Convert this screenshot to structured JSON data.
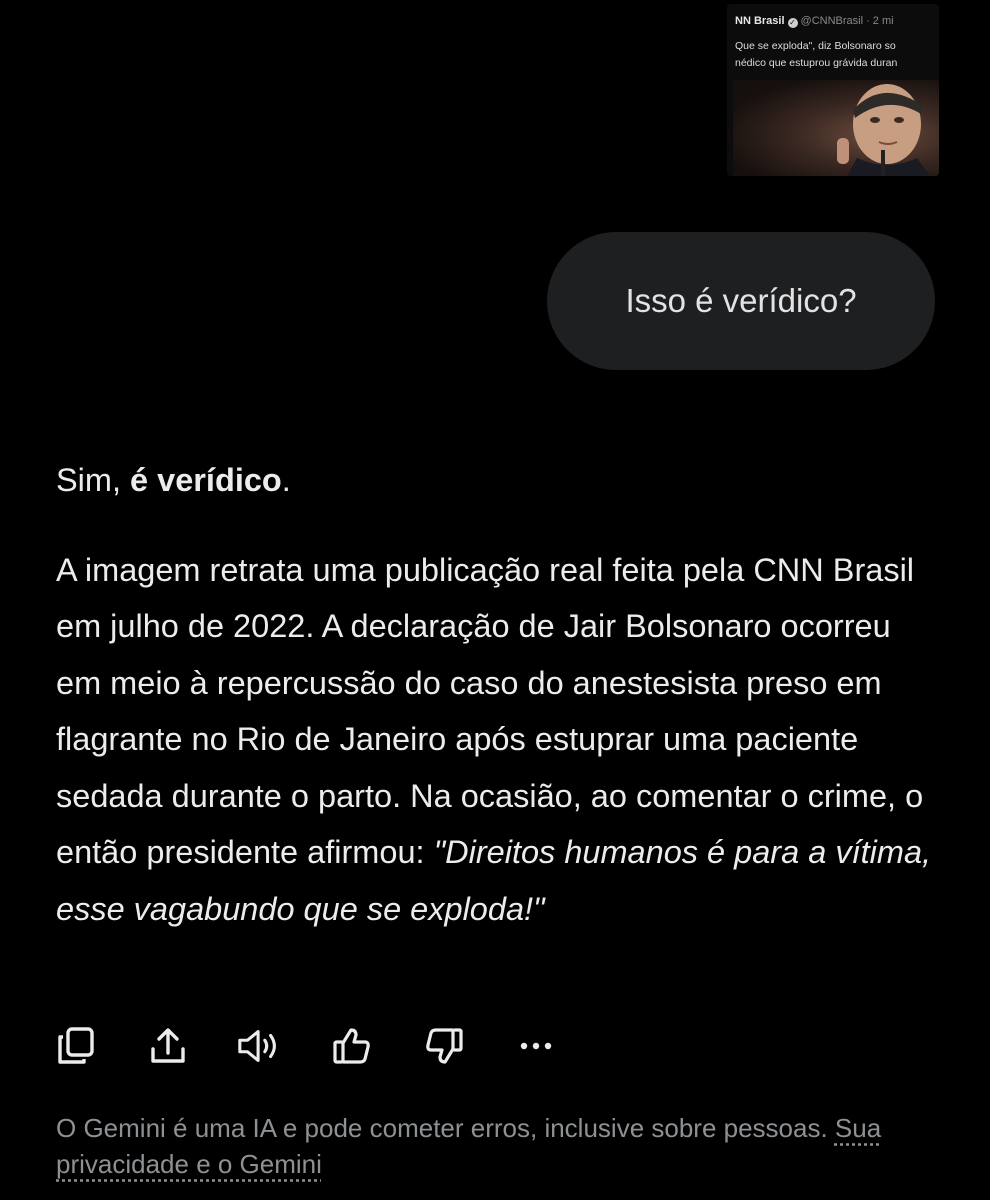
{
  "attachment": {
    "account_name": "NN Brasil",
    "account_meta": "@CNNBrasil · 2 mi",
    "line1": "Que se exploda\", diz Bolsonaro so",
    "line2": "nédico que estuprou grávida duran"
  },
  "user_prompt": "Isso é verídico?",
  "response": {
    "lead_plain": "Sim, ",
    "lead_bold": "é verídico",
    "lead_end": ".",
    "body": "A imagem retrata uma publicação real feita pela CNN Brasil em julho de 2022. A declaração de Jair Bolsonaro ocorreu em meio à repercussão do caso do anestesista preso em flagrante no Rio de Janeiro após estuprar uma paciente sedada durante o parto. Na ocasião, ao comentar o crime, o então presidente afirmou: ",
    "quote": "\"Direitos humanos é para a vítima, esse vagabundo que se exploda!\""
  },
  "actions": {
    "icons": [
      "copy-icon",
      "share-icon",
      "listen-icon",
      "thumbs-up-icon",
      "thumbs-down-icon",
      "more-options-icon"
    ]
  },
  "disclaimer": {
    "text": "O Gemini é uma IA e pode cometer erros, inclusive sobre pessoas. ",
    "link": "Sua privacidade e o Gemini"
  },
  "colors": {
    "background": "#000000",
    "bubble": "#1e1f20",
    "text": "#ececec",
    "muted": "#8e9194"
  }
}
